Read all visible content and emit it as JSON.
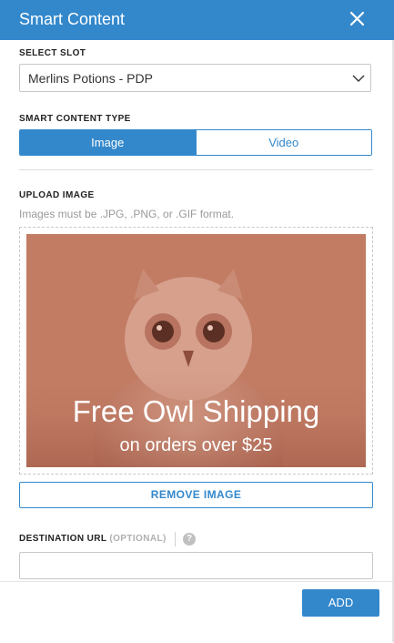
{
  "header": {
    "title": "Smart Content",
    "close_icon": "close-icon"
  },
  "select_slot": {
    "label": "SELECT SLOT",
    "value": "Merlins Potions - PDP"
  },
  "content_type": {
    "label": "SMART CONTENT TYPE",
    "options": [
      "Image",
      "Video"
    ],
    "selected": "Image"
  },
  "upload": {
    "label": "UPLOAD IMAGE",
    "help": "Images must be .JPG, .PNG, or .GIF format.",
    "image": {
      "line1": "Free Owl Shipping",
      "line2": "on orders over $25"
    },
    "remove_label": "REMOVE IMAGE"
  },
  "destination": {
    "label": "DESTINATION URL",
    "optional": "(OPTIONAL)",
    "help_icon": "help-icon"
  },
  "footer": {
    "add_label": "ADD"
  },
  "colors": {
    "accent": "#3388cc",
    "image_tint": "#c27c64"
  }
}
